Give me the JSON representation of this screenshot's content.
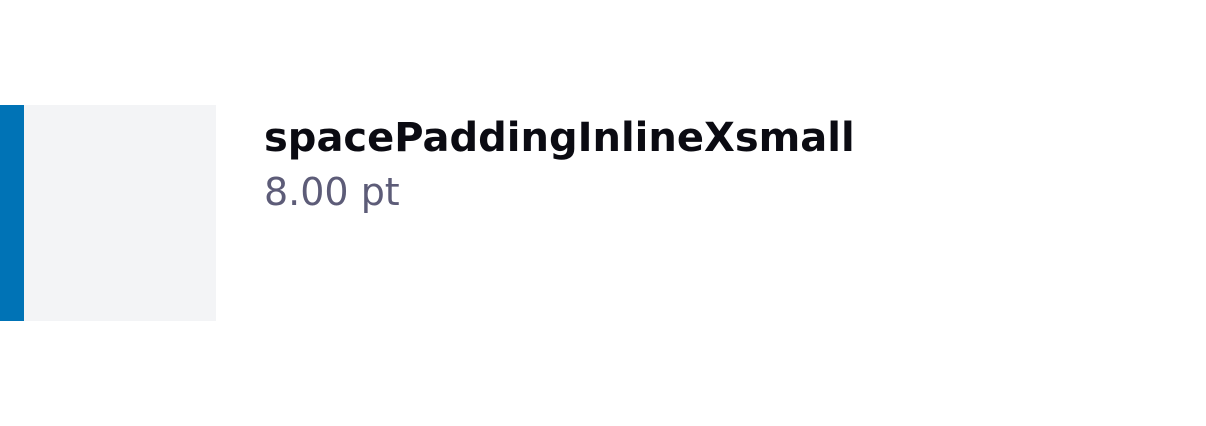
{
  "token": {
    "name": "spacePaddingInlineXsmall",
    "value": "8.00 pt"
  },
  "colors": {
    "swatch_background": "#f3f4f6",
    "swatch_accent": "#0073b6",
    "name_text": "#0b0b12",
    "value_text": "#5d5c78"
  }
}
